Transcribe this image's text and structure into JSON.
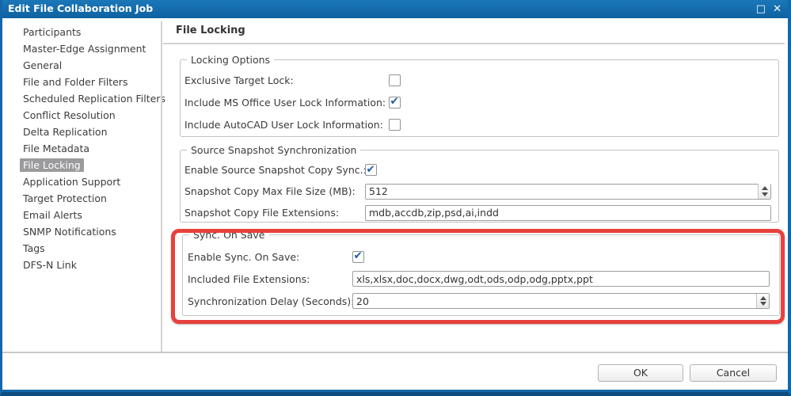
{
  "window": {
    "title": "Edit File Collaboration Job",
    "maximize_icon": "□",
    "close_icon": "✕"
  },
  "colors": {
    "titlebar_blue": "#1467a8",
    "selected_item_bg": "#9b9b9d",
    "highlight_red": "#e8413c",
    "checkmark_blue": "#1b5da6"
  },
  "sidebar": {
    "items": [
      {
        "label": "Participants",
        "selected": false
      },
      {
        "label": "Master-Edge Assignment",
        "selected": false
      },
      {
        "label": "General",
        "selected": false
      },
      {
        "label": "File and Folder Filters",
        "selected": false
      },
      {
        "label": "Scheduled Replication Filters",
        "selected": false
      },
      {
        "label": "Conflict Resolution",
        "selected": false
      },
      {
        "label": "Delta Replication",
        "selected": false
      },
      {
        "label": "File Metadata",
        "selected": false
      },
      {
        "label": "File Locking",
        "selected": true
      },
      {
        "label": "Application Support",
        "selected": false
      },
      {
        "label": "Target Protection",
        "selected": false
      },
      {
        "label": "Email Alerts",
        "selected": false
      },
      {
        "label": "SNMP Notifications",
        "selected": false
      },
      {
        "label": "Tags",
        "selected": false
      },
      {
        "label": "DFS-N Link",
        "selected": false
      }
    ]
  },
  "main": {
    "title": "File Locking",
    "groups": [
      {
        "legend": "Locking Options",
        "highlighted": false,
        "rows": [
          {
            "label": "Exclusive Target Lock:",
            "type": "checkbox",
            "checked": false
          },
          {
            "label": "Include MS Office User Lock Information:",
            "type": "checkbox",
            "checked": true
          },
          {
            "label": "Include AutoCAD User Lock Information:",
            "type": "checkbox",
            "checked": false
          }
        ]
      },
      {
        "legend": "Source Snapshot Synchronization",
        "highlighted": false,
        "rows": [
          {
            "label": "Enable Source Snapshot Copy Sync.:",
            "type": "checkbox",
            "checked": true
          },
          {
            "label": "Snapshot Copy Max File Size (MB):",
            "type": "spinner",
            "value": "512"
          },
          {
            "label": "Snapshot Copy File Extensions:",
            "type": "text",
            "value": "mdb,accdb,zip,psd,ai,indd"
          }
        ]
      },
      {
        "legend": "Sync. On Save",
        "highlighted": true,
        "rows": [
          {
            "label": "Enable Sync. On Save:",
            "type": "checkbox",
            "checked": true
          },
          {
            "label": "Included File Extensions:",
            "type": "text",
            "value": "xls,xlsx,doc,docx,dwg,odt,ods,odp,odg,pptx,ppt"
          },
          {
            "label": "Synchronization Delay (Seconds):",
            "type": "spinner",
            "value": "20"
          }
        ]
      }
    ]
  },
  "footer": {
    "ok_label": "OK",
    "cancel_label": "Cancel"
  }
}
